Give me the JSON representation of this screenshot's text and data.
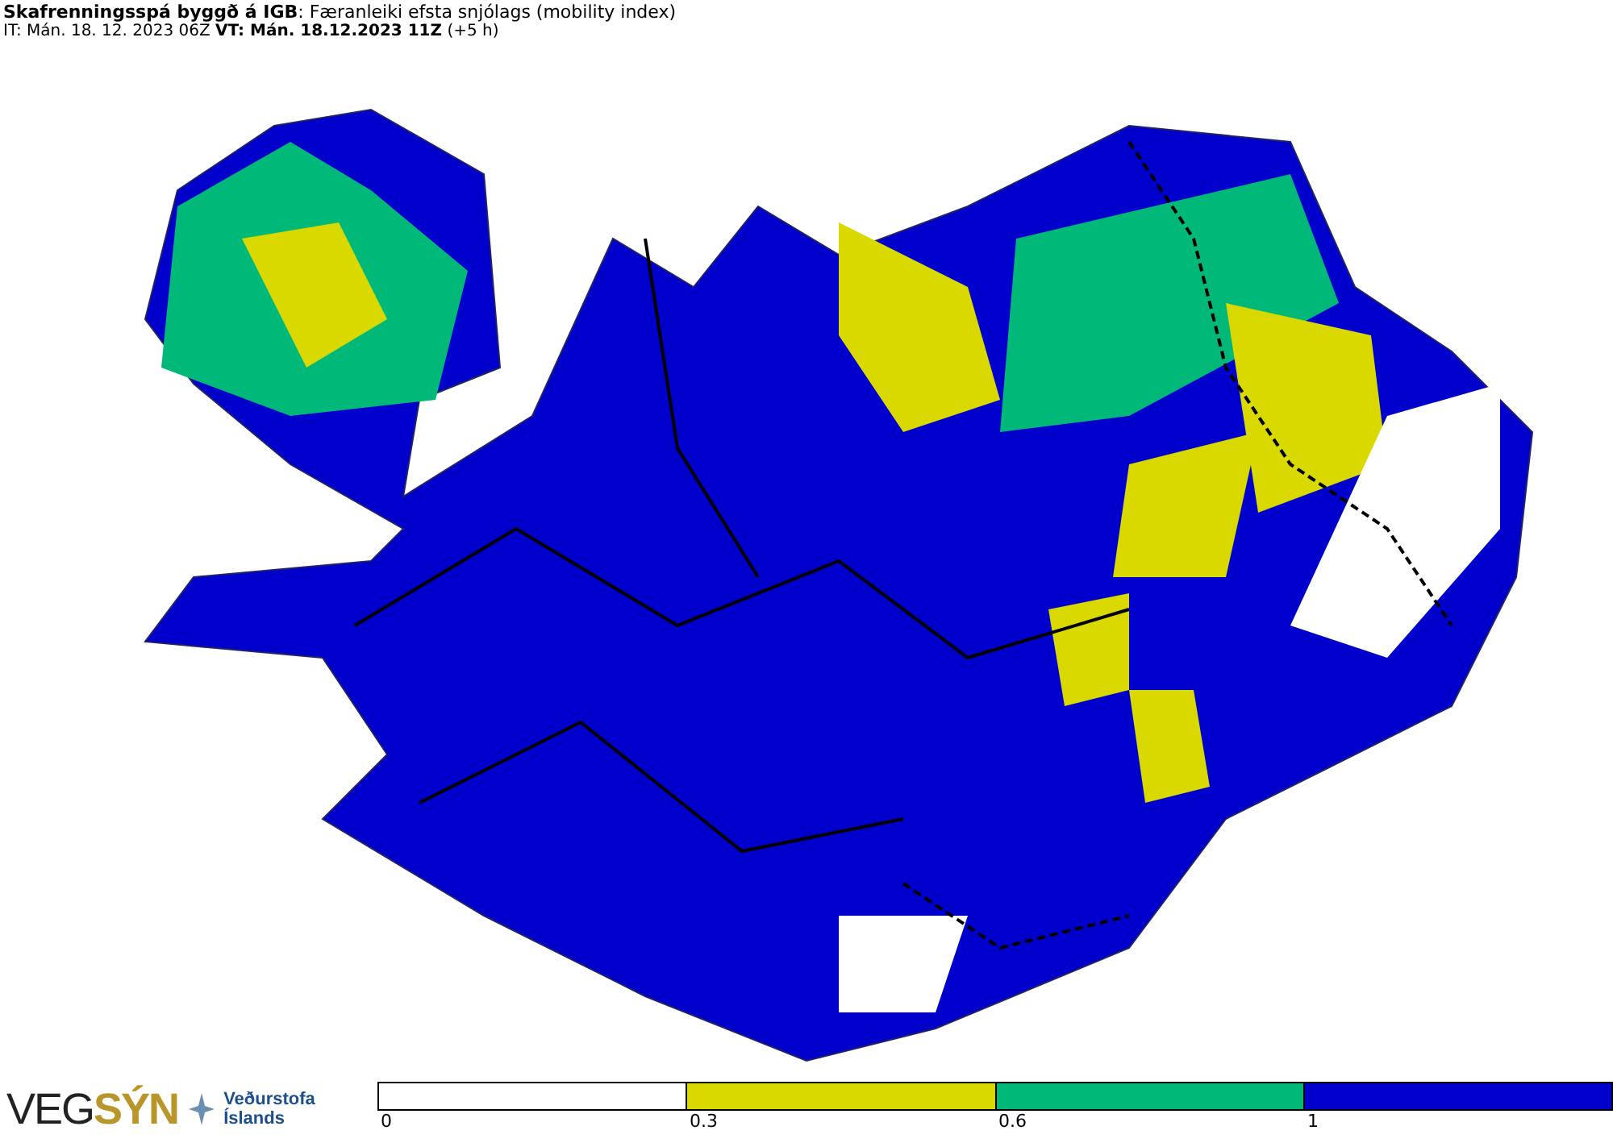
{
  "header": {
    "title": "**Skafrenningsspá byggð á IGB**: Færanleiki efsta snjólags (mobility index)",
    "subtitle": "IT: Mán. 18. 12. 2023 06Z **VT: Mán. 18.12.2023 11Z** (+5 h)"
  },
  "logos": {
    "vegsyn": [
      "VEG",
      "SÝN"
    ],
    "vedurstofa": [
      "Veðurstofa",
      "Íslands"
    ]
  },
  "legend": {
    "segments": [
      {
        "color": "#ffffff"
      },
      {
        "color": "#d9d900"
      },
      {
        "color": "#00b878"
      },
      {
        "color": "#0000cc"
      }
    ],
    "ticks": [
      "0",
      "0.3",
      "0.6",
      "1"
    ]
  }
}
